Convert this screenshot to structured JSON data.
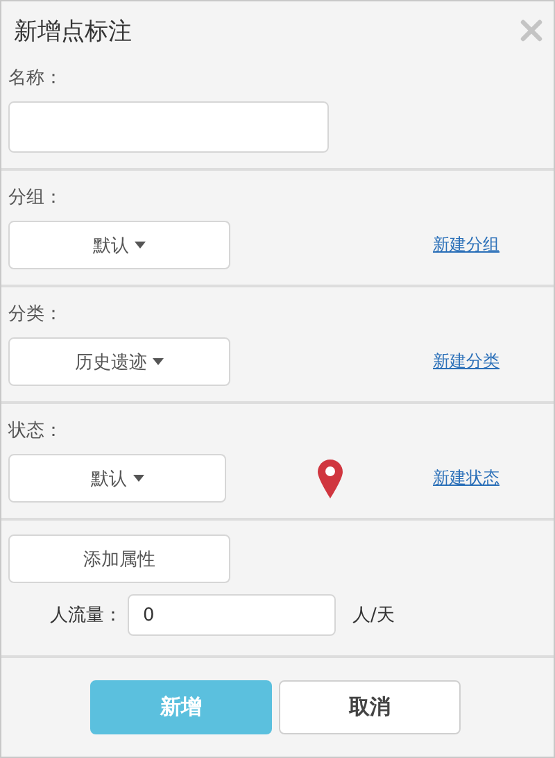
{
  "window": {
    "title": "新增点标注"
  },
  "sections": [
    {
      "kind": "text",
      "label": "名称："
    },
    {
      "kind": "select",
      "label": "分组：",
      "value": "默认",
      "link": "新建分组"
    },
    {
      "kind": "select",
      "label": "分类：",
      "value": "历史遗迹",
      "link": "新建分类"
    },
    {
      "kind": "select",
      "label": "状态：",
      "value": "默认",
      "link": "新建状态",
      "marker": true
    },
    {
      "kind": "attributes",
      "button": "添加属性",
      "field": {
        "label": "人流量：",
        "value": "0",
        "unit": "人/天"
      }
    }
  ],
  "buttons": [
    {
      "label": "新增",
      "primary": true
    },
    {
      "label": "取消",
      "primary": false
    }
  ]
}
